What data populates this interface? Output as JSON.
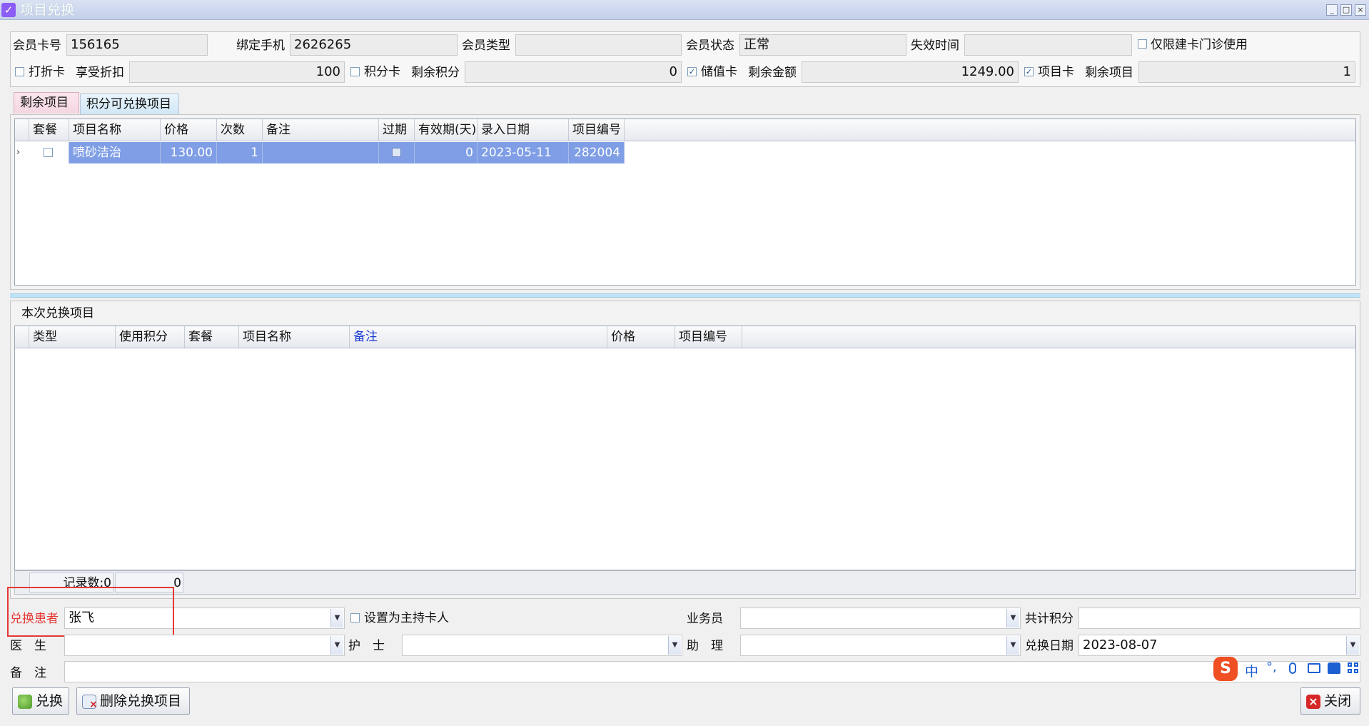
{
  "window": {
    "title": "项目兑换",
    "buttons": [
      "_",
      "□",
      "×"
    ]
  },
  "member": {
    "card_no_label": "会员卡号",
    "card_no": "156165",
    "phone_label": "绑定手机",
    "phone": "2626265",
    "type_label": "会员类型",
    "type": "",
    "status_label": "会员状态",
    "status": "正常",
    "expire_label": "失效时间",
    "expire": "",
    "clinic_only_label": "仅限建卡门诊使用",
    "discount_card_label": "打折卡",
    "discount_label": "享受折扣",
    "discount": "100",
    "points_card_label": "积分卡",
    "points_left_label": "剩余积分",
    "points_left": "0",
    "stored_card_label": "储值卡",
    "balance_label": "剩余金额",
    "balance": "1249.00",
    "item_card_label": "项目卡",
    "items_left_label": "剩余项目",
    "items_left": "1"
  },
  "tabs": [
    {
      "label": "剩余项目",
      "active": true
    },
    {
      "label": "积分可兑换项目",
      "active": false
    }
  ],
  "remaining_grid": {
    "columns": [
      "套餐",
      "项目名称",
      "价格",
      "次数",
      "备注",
      "过期",
      "有效期(天)",
      "录入日期",
      "项目编号"
    ],
    "rows": [
      {
        "package": "",
        "name": "喷砂洁治",
        "price": "130.00",
        "count": "1",
        "note": "",
        "expired": "",
        "valid_days": "0",
        "date": "2023-05-11",
        "code": "282004"
      }
    ]
  },
  "exchange_section": {
    "title": "本次兑换项目",
    "columns": [
      "类型",
      "使用积分",
      "套餐",
      "项目名称",
      "备注",
      "价格",
      "项目编号"
    ],
    "footer_label": "记录数:0",
    "footer_value": "0"
  },
  "form": {
    "patient_label": "兑换患者",
    "patient": "张飞",
    "set_holder_label": "设置为主持卡人",
    "salesman_label": "业务员",
    "salesman": "",
    "total_points_label": "共计积分",
    "total_points": "",
    "doctor_label": "医　生",
    "doctor": "",
    "nurse_label": "护　士",
    "nurse": "",
    "assistant_label": "助　理",
    "assistant": "",
    "date_label": "兑换日期",
    "date": "2023-08-07",
    "note_label": "备　注",
    "note": ""
  },
  "ime": {
    "lang": "中"
  },
  "actions": {
    "exchange": "兑换",
    "delete": "删除兑换项目",
    "close": "关闭"
  },
  "colors": {
    "selected_row": "#7f9ee6",
    "highlight_box": "#e53935",
    "patient_label": "#e53935"
  }
}
